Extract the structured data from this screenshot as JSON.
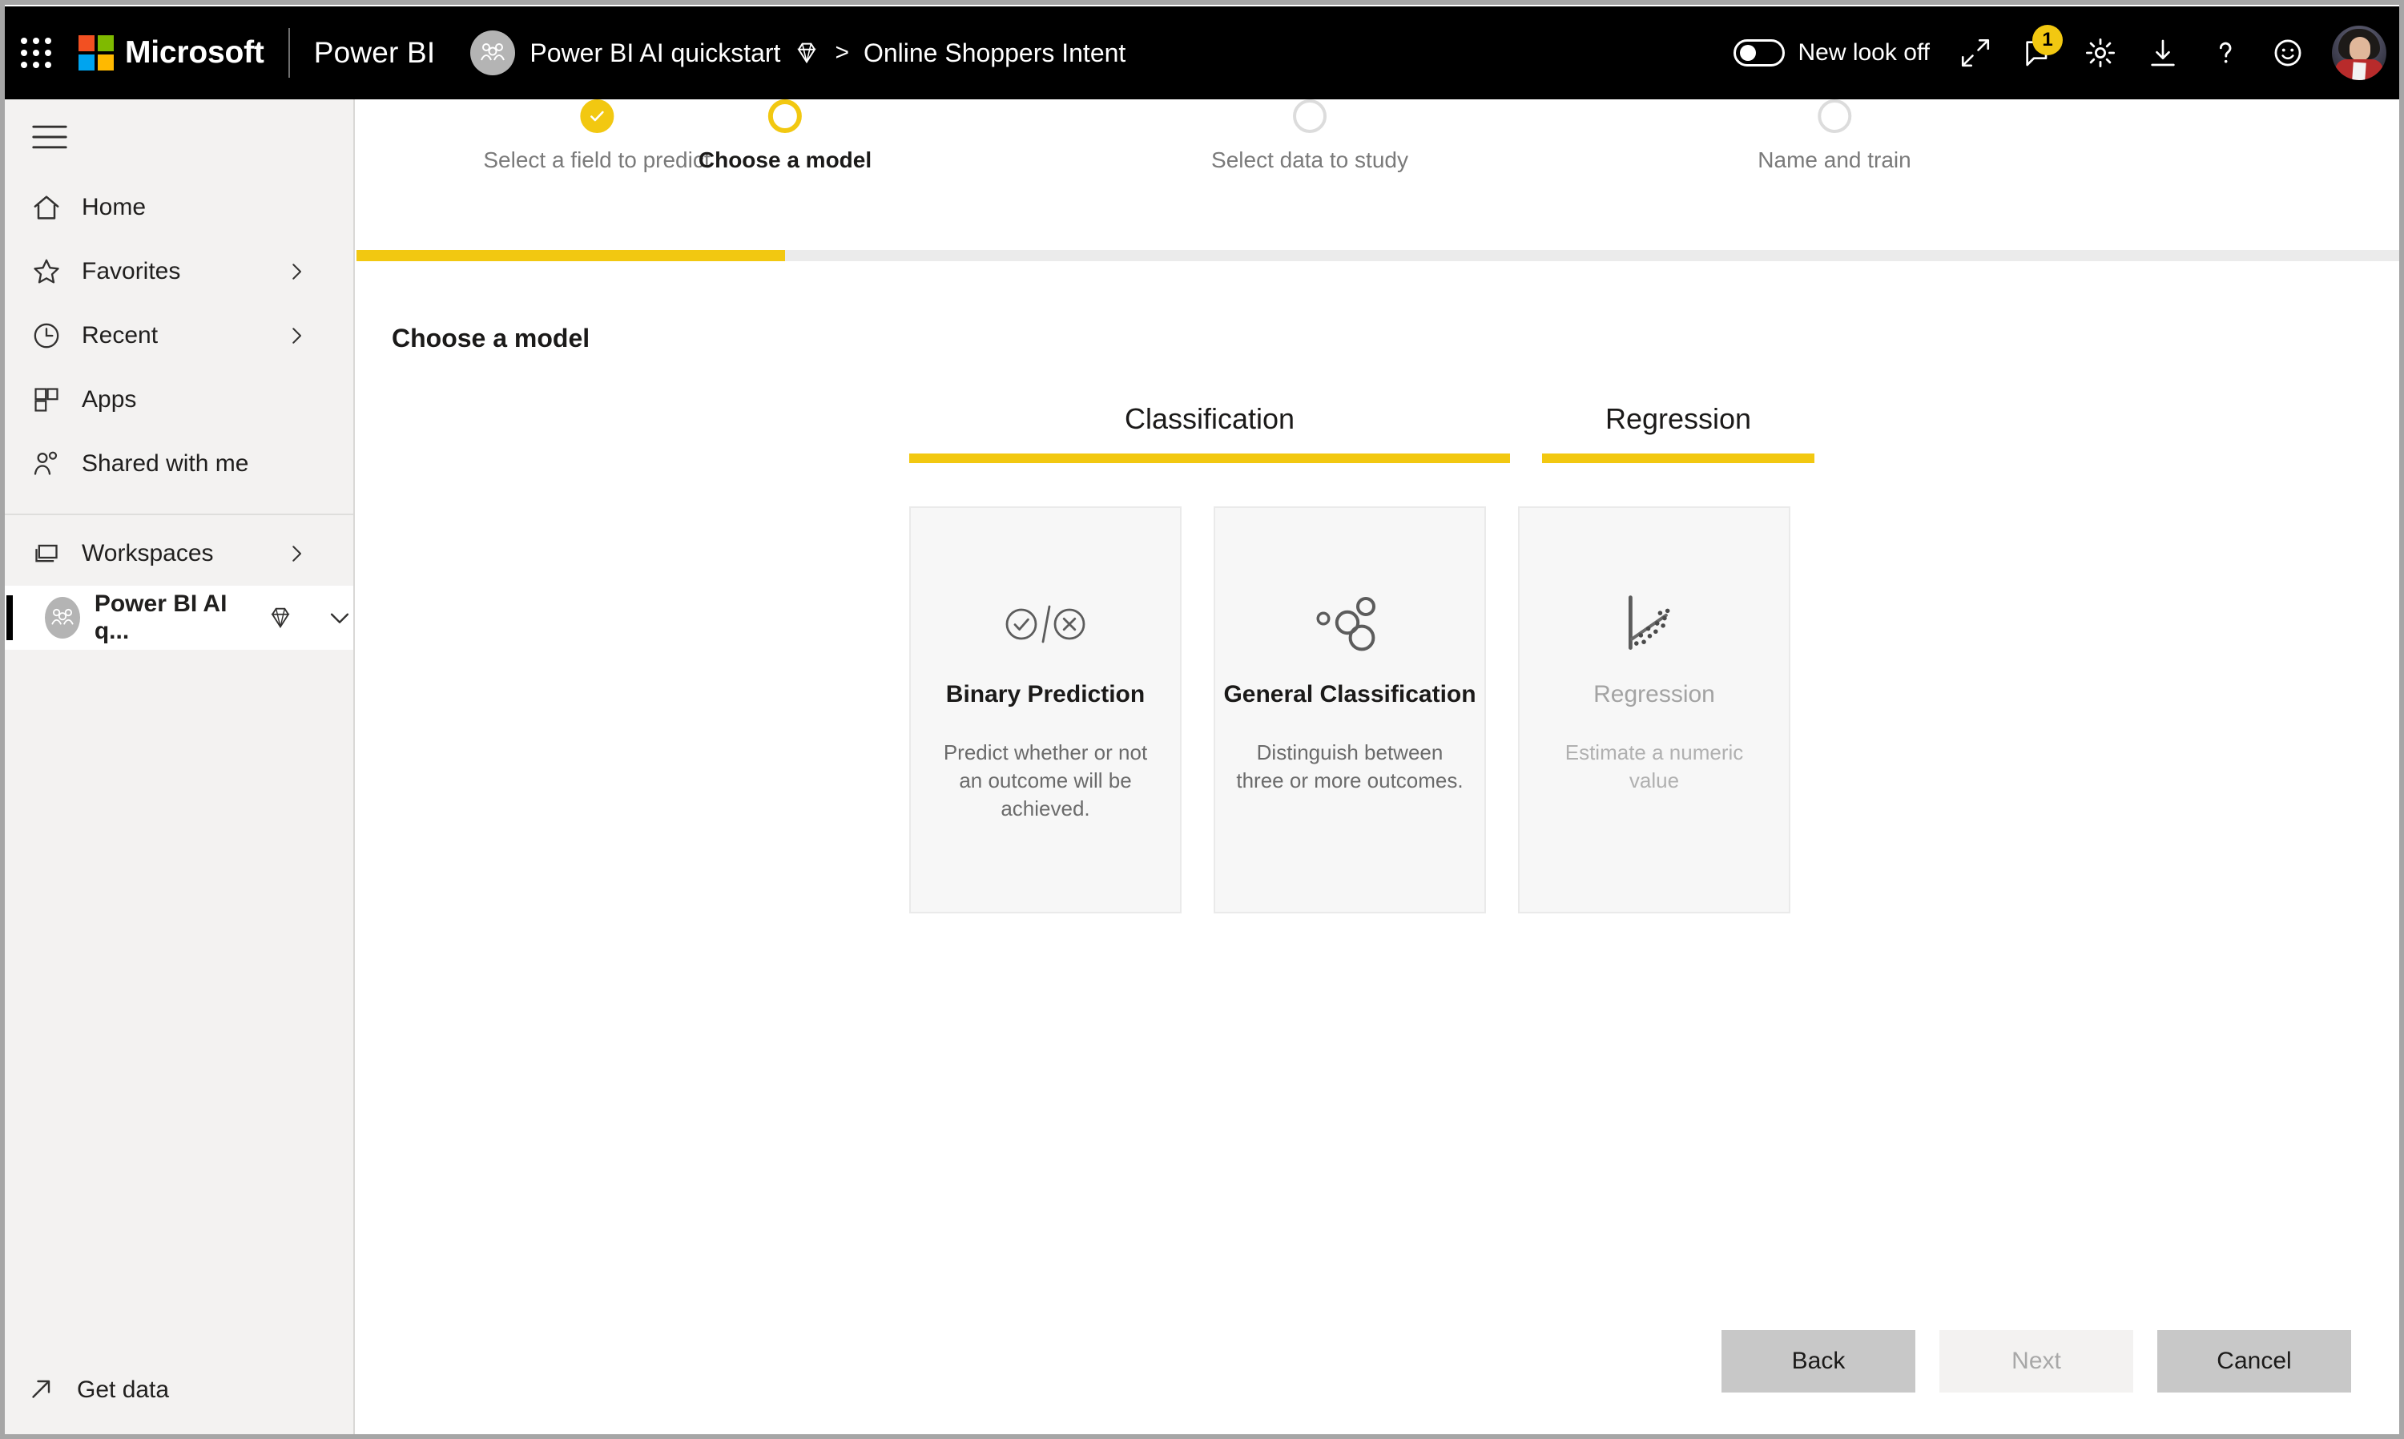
{
  "topbar": {
    "app_launcher": "app-launcher",
    "brand": "Microsoft",
    "product": "Power BI",
    "breadcrumb": {
      "workspace": "Power BI AI quickstart",
      "separator": ">",
      "item": "Online Shoppers Intent"
    },
    "new_look_label": "New look off",
    "new_look_state": "off",
    "notification_badge": "1",
    "icons": [
      "expand-icon",
      "notification-icon",
      "settings-gear-icon",
      "download-icon",
      "help-icon",
      "feedback-smiley-icon"
    ],
    "accent": "#F2C811"
  },
  "sidebar": {
    "items": [
      {
        "label": "Home",
        "icon": "home-icon",
        "chevron": false
      },
      {
        "label": "Favorites",
        "icon": "star-icon",
        "chevron": true
      },
      {
        "label": "Recent",
        "icon": "clock-icon",
        "chevron": true
      },
      {
        "label": "Apps",
        "icon": "apps-grid-icon",
        "chevron": false
      },
      {
        "label": "Shared with me",
        "icon": "people-icon",
        "chevron": false
      }
    ],
    "workspaces_label": "Workspaces",
    "active_workspace": "Power BI AI q...",
    "get_data_label": "Get data"
  },
  "stepper": {
    "steps": [
      {
        "label": "Select a field to predict",
        "state": "done"
      },
      {
        "label": "Choose a model",
        "state": "current"
      },
      {
        "label": "Select data to study",
        "state": "todo"
      },
      {
        "label": "Name and train",
        "state": "todo"
      }
    ]
  },
  "main": {
    "page_title": "Choose a model",
    "tabs": [
      {
        "label": "Classification",
        "active": true
      },
      {
        "label": "Regression",
        "active": true
      }
    ],
    "cards": [
      {
        "title": "Binary Prediction",
        "description": "Predict whether or not an outcome will be achieved.",
        "icon": "check-slash-x-icon",
        "disabled": false
      },
      {
        "title": "General Classification",
        "description": "Distinguish between three or more outcomes.",
        "icon": "cluster-bubbles-icon",
        "disabled": false
      },
      {
        "title": "Regression",
        "description": "Estimate a numeric value",
        "icon": "scatter-trendline-icon",
        "disabled": true
      }
    ]
  },
  "footer": {
    "back_label": "Back",
    "next_label": "Next",
    "cancel_label": "Cancel",
    "next_enabled": false
  }
}
